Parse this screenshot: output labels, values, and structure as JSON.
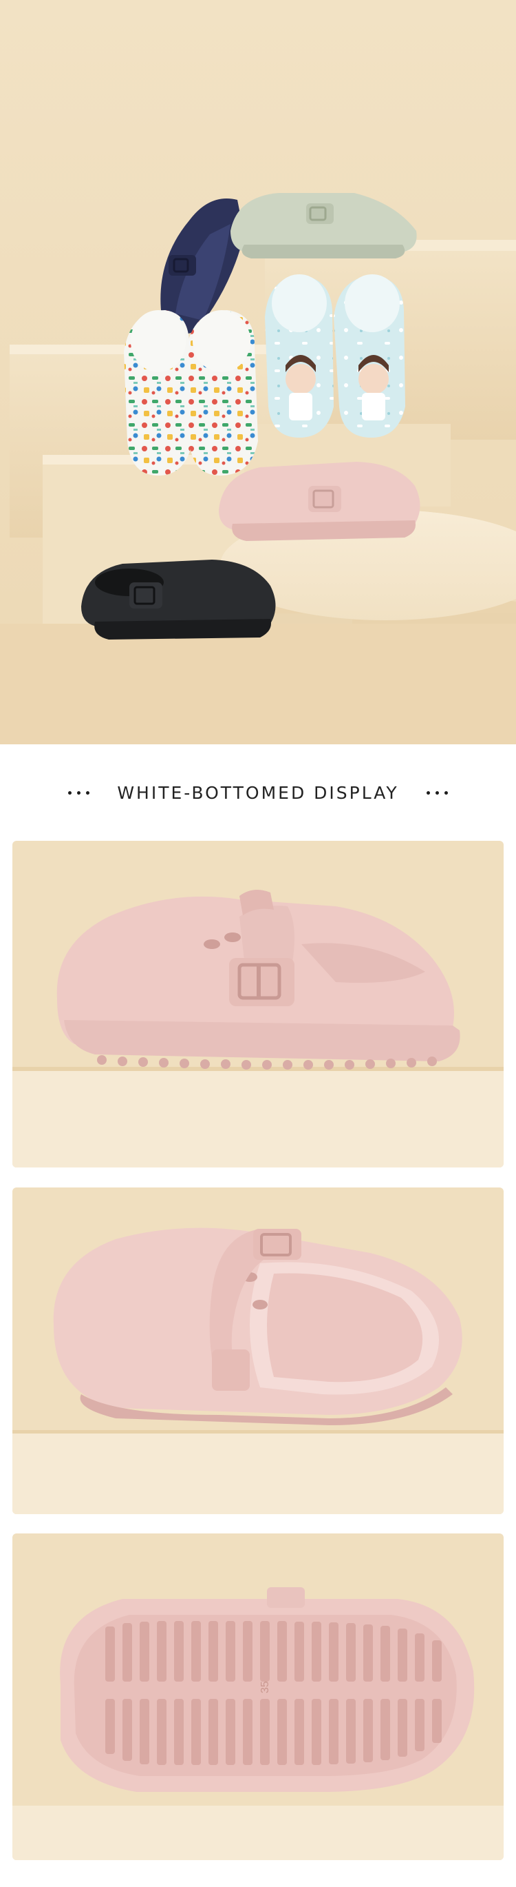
{
  "section_title": "WHITE-BOTTOMED DISPLAY",
  "sole_size_marking": "35",
  "colors": {
    "background_cream": "#f1dfbf",
    "pedestal": "#f4e6ca",
    "clog_pink": "#eec8c4",
    "clog_navy": "#2b3156",
    "clog_sage": "#cfd6c4",
    "clog_black": "#26282a",
    "clog_print_light_blue": "#d3ecef"
  },
  "icons": [
    "dots-left-icon",
    "dots-right-icon"
  ]
}
